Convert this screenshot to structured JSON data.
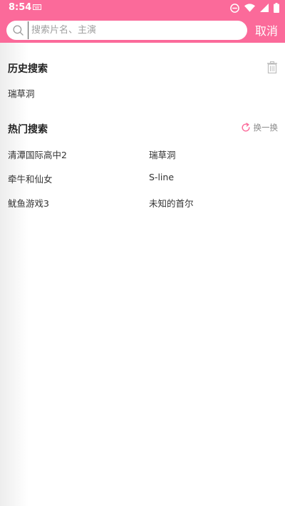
{
  "status_bar": {
    "time": "8:54"
  },
  "search": {
    "placeholder": "搜索片名、主演",
    "value": ""
  },
  "cancel_label": "取消",
  "history": {
    "title": "历史搜索",
    "items": [
      "瑞草洞"
    ]
  },
  "hot": {
    "title": "热门搜索",
    "refresh_label": "换一换",
    "items": [
      "清潭国际高中2",
      "瑞草洞",
      "牵牛和仙女",
      "S-line",
      "鱿鱼游戏3",
      "未知的首尔"
    ]
  },
  "colors": {
    "accent": "#fb6a9a",
    "refresh_icon": "#fb6a9a"
  },
  "icons": {
    "search": "search-icon",
    "trash": "trash-icon",
    "refresh": "refresh-icon",
    "keyboard": "keyboard-icon",
    "dnd": "do-not-disturb-icon",
    "wifi": "wifi-icon",
    "signal": "signal-icon",
    "battery": "battery-icon"
  }
}
